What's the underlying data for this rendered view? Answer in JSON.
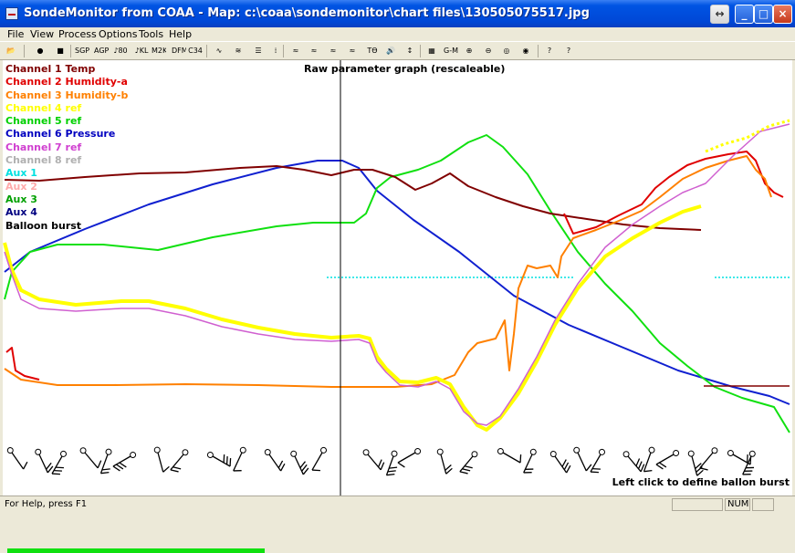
{
  "window": {
    "title": "SondeMonitor from COAA - Map: c:\\coaa\\sondemonitor\\chart files\\130505075517.jpg",
    "controls": [
      "↔",
      "_",
      "□",
      "×"
    ]
  },
  "menu": [
    "File",
    "View",
    "Process",
    "Options",
    "Tools",
    "Help"
  ],
  "toolbar": {
    "tools": [
      {
        "name": "open-icon",
        "glyph": "📂"
      },
      {
        "name": "start-icon",
        "glyph": "●"
      },
      {
        "name": "stop-icon",
        "glyph": "■"
      },
      {
        "name": "sgp-icon",
        "glyph": "SGP"
      },
      {
        "name": "agp-icon",
        "glyph": "AGP"
      },
      {
        "name": "note-80-icon",
        "glyph": "♪80"
      },
      {
        "name": "kl-icon",
        "glyph": "♪KL"
      },
      {
        "name": "m2-k2-icon",
        "glyph": "M2K2"
      },
      {
        "name": "dfm-icon",
        "glyph": "DFM"
      },
      {
        "name": "c34-icon",
        "glyph": "C34"
      },
      {
        "name": "wave-icon",
        "glyph": "∿"
      },
      {
        "name": "double-wave-icon",
        "glyph": "≋"
      },
      {
        "name": "lines-icon",
        "glyph": "☰"
      },
      {
        "name": "bars-icon",
        "glyph": "⁞"
      },
      {
        "name": "graph-1-icon",
        "glyph": "≈"
      },
      {
        "name": "graph-2-icon",
        "glyph": "≈"
      },
      {
        "name": "graph-3-icon",
        "glyph": "≈"
      },
      {
        "name": "graph-4-icon",
        "glyph": "≈"
      },
      {
        "name": "temp-dew-icon",
        "glyph": "Tϴ"
      },
      {
        "name": "speaker-icon",
        "glyph": "🔊"
      },
      {
        "name": "updown-icon",
        "glyph": "↕"
      },
      {
        "name": "map-icon",
        "glyph": "▦"
      },
      {
        "name": "gps-icon",
        "glyph": "G-M"
      },
      {
        "name": "zoom-in-icon",
        "glyph": "⊕"
      },
      {
        "name": "zoom-out-icon",
        "glyph": "⊖"
      },
      {
        "name": "target-icon",
        "glyph": "◎"
      },
      {
        "name": "compass-icon",
        "glyph": "◉"
      },
      {
        "name": "help-icon",
        "glyph": "?"
      },
      {
        "name": "context-help-icon",
        "glyph": "?"
      }
    ]
  },
  "graph": {
    "title": "Raw parameter graph (rescaleable)",
    "hint": "Left click to define ballon burst",
    "legend": [
      {
        "label": "Channel 1 Temp",
        "color": "#800000"
      },
      {
        "label": "Channel 2 Humidity-a",
        "color": "#e00000"
      },
      {
        "label": "Channel 3 Humidity-b",
        "color": "#ff8000"
      },
      {
        "label": "Channel 4 ref",
        "color": "#ffff00"
      },
      {
        "label": "Channel 5 ref",
        "color": "#00d000"
      },
      {
        "label": "Channel 6 Pressure",
        "color": "#0000c0"
      },
      {
        "label": "Channel 7 ref",
        "color": "#d040d0"
      },
      {
        "label": "Channel 8 ref",
        "color": "#b0b0b0"
      },
      {
        "label": "Aux 1",
        "color": "#00e0e0"
      },
      {
        "label": "Aux 2",
        "color": "#ffaaaa"
      },
      {
        "label": "Aux 3",
        "color": "#00a000"
      },
      {
        "label": "Aux 4",
        "color": "#000080"
      },
      {
        "label": "Balloon burst",
        "color": "#000000"
      }
    ]
  },
  "status": {
    "text": "For Help, press F1",
    "indicator": "NUM"
  }
}
